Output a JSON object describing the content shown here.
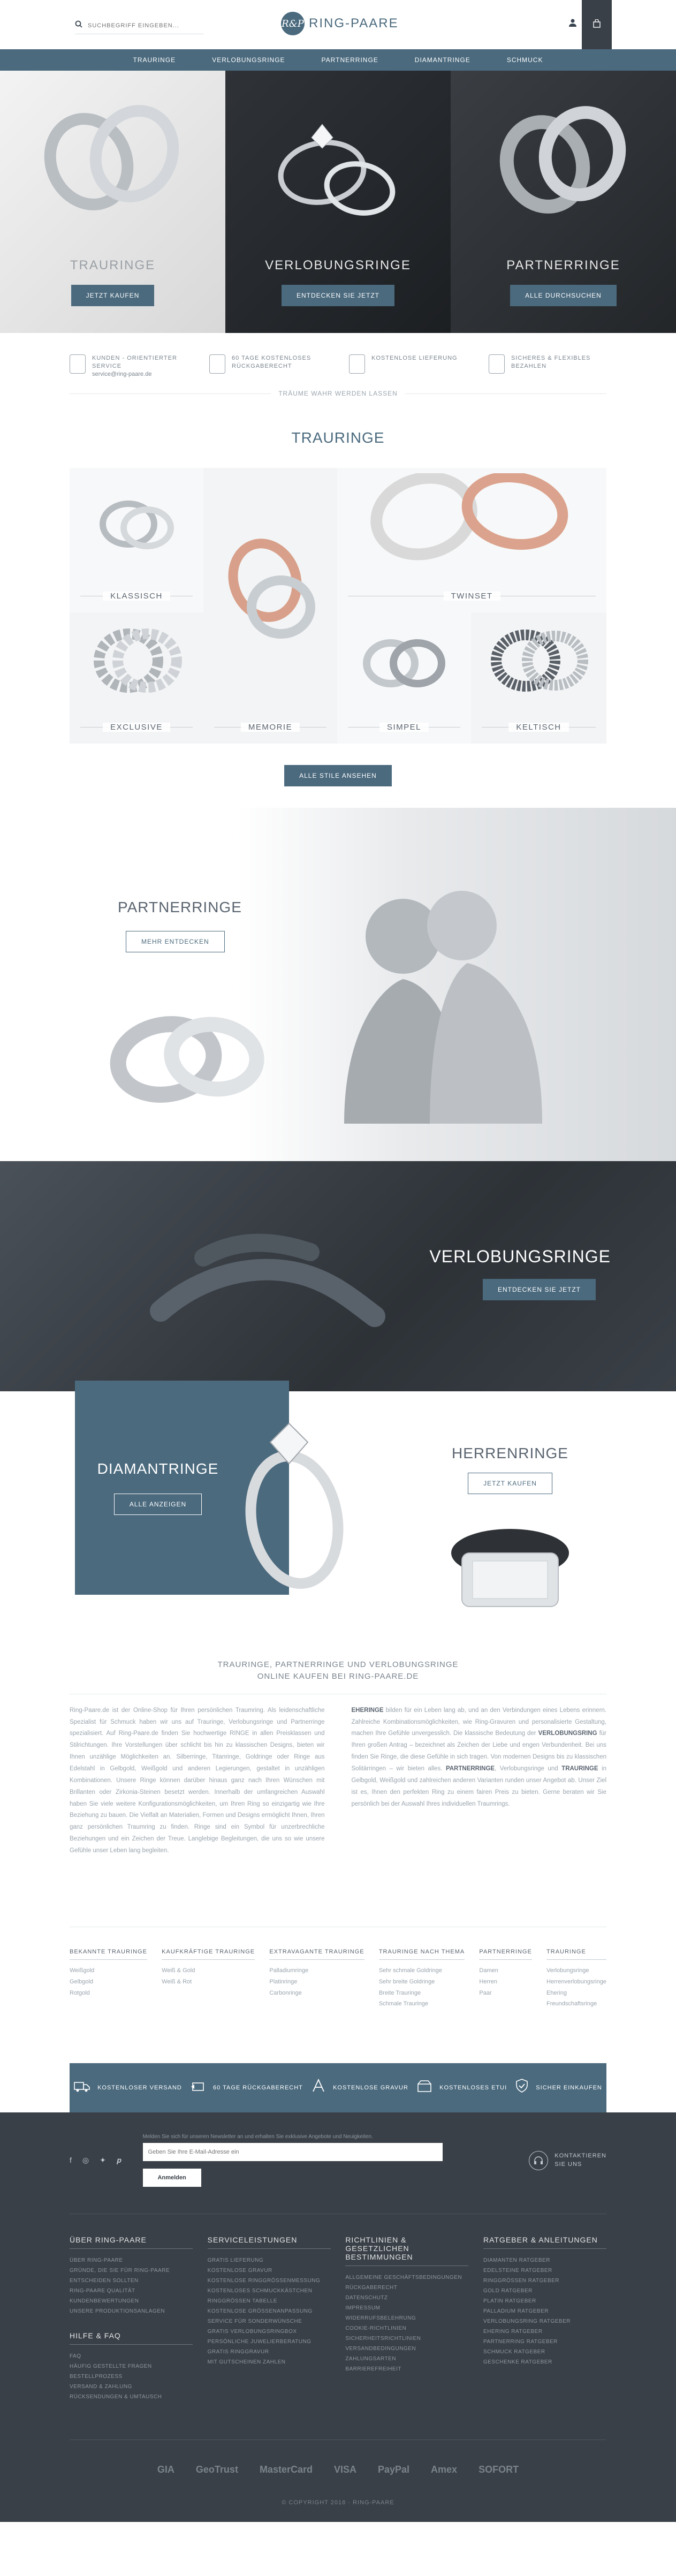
{
  "header": {
    "search_placeholder": "SUCHBEGRIFF EINGEBEN...",
    "logo_mark": "R&P",
    "logo_text": "RING-PAARE"
  },
  "nav": [
    "TRAURINGE",
    "VERLOBUNGSRINGE",
    "PARTNERRINGE",
    "DIAMANTRINGE",
    "SCHMUCK"
  ],
  "hero": [
    {
      "title": "TRAURINGE",
      "button": "JETZT KAUFEN"
    },
    {
      "title": "VERLOBUNGSRINGE",
      "button": "ENTDECKEN SIE JETZT"
    },
    {
      "title": "PARTNERRINGE",
      "button": "ALLE DURCHSUCHEN"
    }
  ],
  "usp": [
    {
      "title": "KUNDEN - ORIENTIERTER SERVICE",
      "sub": "service@ring-paare.de"
    },
    {
      "title": "60 TAGE KOSTENLOSES RÜCKGABERECHT",
      "sub": ""
    },
    {
      "title": "KOSTENLOSE LIEFERUNG",
      "sub": ""
    },
    {
      "title": "SICHERES & FLEXIBLES BEZAHLEN",
      "sub": ""
    }
  ],
  "tagline": "TRÄUME WAHR WERDEN LASSEN",
  "trauringe": {
    "title": "TRAURINGE",
    "tiles": [
      "KLASSISCH",
      "MEMORIE",
      "TWINSET",
      "EXCLUSIVE",
      "SIMPEL",
      "KELTISCH"
    ],
    "button": "ALLE STILE ANSEHEN"
  },
  "partner": {
    "title": "PARTNERRINGE",
    "button": "MEHR ENTDECKEN"
  },
  "verlobung": {
    "title": "VERLOBUNGSRINGE",
    "button": "ENTDECKEN SIE JETZT"
  },
  "diamant": {
    "title": "DIAMANTRINGE",
    "button": "ALLE ANZEIGEN"
  },
  "herren": {
    "title": "HERRENRINGE",
    "button": "JETZT KAUFEN"
  },
  "seo": {
    "heading_1": "TRAURINGE, PARTNERRINGE UND VERLOBUNGSRINGE",
    "heading_2": "ONLINE KAUFEN BEI RING-PAARE.DE",
    "left": "Ring-Paare.de ist der Online-Shop für Ihren persönlichen Traumring. Als leidenschaftliche Spezialist für Schmuck haben wir uns auf Trauringe, Verlobungsringe und Partnerringe spezialisiert. Auf Ring-Paare.de finden Sie hochwertige RINGE in allen Preisklassen und Stilrichtungen. Ihre Vorstellungen über schlicht bis hin zu klassischen Designs, bieten wir Ihnen unzählige Möglichkeiten an. Silberringe, Titanringe, Goldringe oder Ringe aus Edelstahl in Gelbgold, Weißgold und anderen Legierungen, gestaltet in unzähligen Kombinationen. Unsere Ringe können darüber hinaus ganz nach Ihren Wünschen mit Brillanten oder Zirkonia-Steinen besetzt werden. Innerhalb der umfangreichen Auswahl haben Sie viele weitere Konfigurationsmöglichkeiten, um Ihren Ring so einzigartig wie Ihre Beziehung zu bauen. Die Vielfalt an Materialien, Formen und Designs ermöglicht Ihnen, Ihren ganz persönlichen Traumring zu finden. Ringe sind ein Symbol für unzerbrechliche Beziehungen und ein Zeichen der Treue. Langlebige Begleitungen, die uns so wie unsere Gefühle unser Leben lang begleiten.",
    "right_b1": "EHERINGE",
    "right_t1": " bilden für ein Leben lang ab, und an den Verbindungen eines Lebens erinnern. Zahlreiche Kombinationsmöglichkeiten, wie Ring-Gravuren und personalisierte Gestaltung, machen Ihre Gefühle unvergesslich. Die klassische Bedeutung der",
    "right_b2": "VERLOBUNGSRING",
    "right_t2": " für Ihren großen Antrag – bezeichnet als Zeichen der Liebe und engen Verbundenheit. Bei uns finden Sie Ringe, die diese Gefühle in sich tragen. Von modernen Designs bis zu klassischen Solitärringen – wir bieten alles.",
    "right_b3": "PARTNERRINGE",
    "right_t3": ", Verlobungsringe und",
    "right_b4": "TRAURINGE",
    "right_t4": " in Gelbgold, Weißgold und zahlreichen anderen Varianten runden unser Angebot ab. Unser Ziel ist es, Ihnen den perfekten Ring zu einem fairen Preis zu bieten. Gerne beraten wir Sie persönlich bei der Auswahl Ihres individuellen Traumrings."
  },
  "linkcols": [
    {
      "title": "BEKANNTE TRAURINGE",
      "items": [
        "Weißgold",
        "Gelbgold",
        "Rotgold"
      ]
    },
    {
      "title": "KAUFKRÄFTIGE TRAURINGE",
      "items": [
        "Weiß & Gold",
        "Weiß & Rot"
      ]
    },
    {
      "title": "EXTRAVAGANTE TRAURINGE",
      "items": [
        "Palladiumringe",
        "Platinringe",
        "Carbonringe"
      ]
    },
    {
      "title": "TRAURINGE NACH THEMA",
      "items": [
        "Sehr schmale Goldringe",
        "Sehr breite Goldringe",
        "Breite Trauringe",
        "Schmale Trauringe"
      ]
    },
    {
      "title": "PARTNERRINGE",
      "items": [
        "Damen",
        "Herren",
        "Paar"
      ]
    },
    {
      "title": "TRAURINGE",
      "items": [
        "Verlobungsringe",
        "Herrenverlobungsringe",
        "Ehering",
        "Freundschaftsringe"
      ]
    }
  ],
  "benefits": [
    {
      "icon": "truck-icon",
      "text": "KOSTENLOSER VERSAND"
    },
    {
      "icon": "return-icon",
      "text": "60 TAGE RÜCKGABERECHT"
    },
    {
      "icon": "engraving-icon",
      "text": "KOSTENLOSE GRAVUR"
    },
    {
      "icon": "gift-box-icon",
      "text": "KOSTENLOSES ETUI"
    },
    {
      "icon": "shield-icon",
      "text": "SICHER EINKAUFEN"
    }
  ],
  "footer": {
    "newsletter_note": "Melden Sie sich für unseren Newsletter an und erhalten Sie exklusive Angebote und Neuigkeiten.",
    "newsletter_placeholder": "Geben Sie Ihre E-Mail-Adresse ein",
    "newsletter_button": "Anmelden",
    "contact_1": "KONTAKTIEREN",
    "contact_2": "SIE UNS",
    "cols": [
      {
        "title": "ÜBER RING-PAARE",
        "items": [
          "Über Ring-Paare",
          "Gründe, die Sie für Ring-Paare entscheiden sollten",
          "Ring-Paare Qualität",
          "Kundenbewertungen",
          "Unsere Produktionsanlagen"
        ],
        "title2": "HILFE & FAQ",
        "items2": [
          "FAQ",
          "Häufig gestellte Fragen",
          "Bestellprozess",
          "Versand & Zahlung",
          "Rücksendungen & Umtausch"
        ]
      },
      {
        "title": "SERVICELEISTUNGEN",
        "items": [
          "Gratis Lieferung",
          "Kostenlose Gravur",
          "Kostenlose Ringgrößenmessung",
          "Kostenloses Schmuckkästchen",
          "Ringgrößen Tabelle",
          "Kostenlose Größenanpassung",
          "Service für Sonderwünsche",
          "Gratis Verlobungsringbox",
          "Persönliche Juwelierberatung",
          "Gratis Ringgravur",
          "Mit Gutscheinen zahlen"
        ]
      },
      {
        "title": "RICHTLINIEN & GESETZLICHEN BESTIMMUNGEN",
        "items": [
          "Allgemeine Geschäftsbedingungen",
          "Rückgaberecht",
          "Datenschutz",
          "Impressum",
          "Widerrufsbelehrung",
          "Cookie-Richtlinien",
          "Sicherheitsrichtlinien",
          "Versandbedingungen",
          "Zahlungsarten",
          "Barrierefreiheit"
        ]
      },
      {
        "title": "RATGEBER & ANLEITUNGEN",
        "items": [
          "Diamanten Ratgeber",
          "Edelsteine Ratgeber",
          "Ringgrößen Ratgeber",
          "Gold Ratgeber",
          "Platin Ratgeber",
          "Palladium Ratgeber",
          "Verlobungsring Ratgeber",
          "Ehering Ratgeber",
          "Partnerring Ratgeber",
          "Schmuck Ratgeber",
          "Geschenke Ratgeber"
        ]
      }
    ],
    "payments": [
      "GIA",
      "GeoTrust",
      "MasterCard",
      "VISA",
      "PayPal",
      "Amex",
      "SOFORT"
    ],
    "copyright": "© COPYRIGHT 2018 · RING-PAARE"
  }
}
